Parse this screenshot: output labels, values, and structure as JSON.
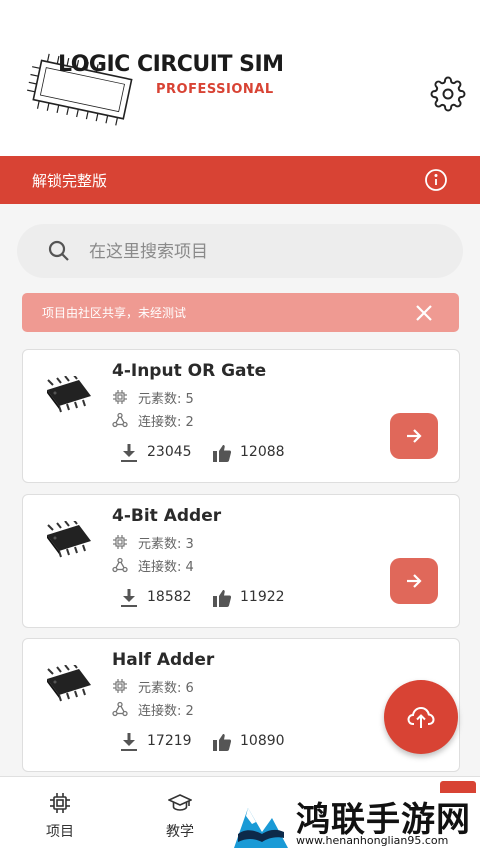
{
  "app": {
    "logo_title": "LOGIC CIRCUIT SIM",
    "logo_subtitle": "PROFESSIONAL",
    "accent_color": "#d84334"
  },
  "banner": {
    "label": "解锁完整版",
    "icon": "info-icon"
  },
  "search": {
    "placeholder": "在这里搜索项目",
    "value": ""
  },
  "notice": {
    "text": "项目由社区共享，未经测试",
    "close_icon": "close-icon"
  },
  "projects": [
    {
      "title": "4-Input OR Gate",
      "elements": "元素数: 5",
      "connections": "连接数: 2",
      "downloads": "23045",
      "likes": "12088"
    },
    {
      "title": "4-Bit Adder",
      "elements": "元素数: 3",
      "connections": "连接数: 4",
      "downloads": "18582",
      "likes": "11922"
    },
    {
      "title": "Half Adder",
      "elements": "元素数: 6",
      "connections": "连接数: 2",
      "downloads": "17219",
      "likes": "10890"
    }
  ],
  "fab": {
    "icon": "cloud-upload-icon"
  },
  "nav": [
    {
      "label": "项目",
      "icon": "chip-icon"
    },
    {
      "label": "教学",
      "icon": "graduation-cap-icon"
    }
  ],
  "watermark": {
    "title": "鸿联手游网",
    "url": "www.henanhonglian95.com"
  }
}
